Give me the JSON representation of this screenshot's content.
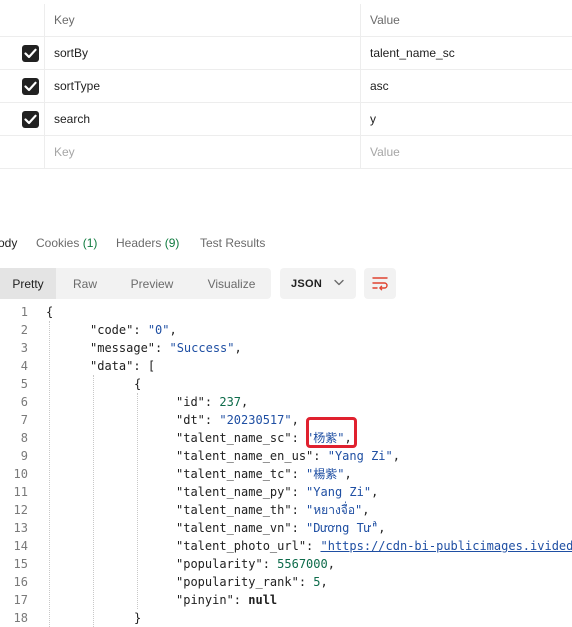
{
  "params": {
    "header": {
      "key": "Key",
      "value": "Value"
    },
    "rows": [
      {
        "key": "sortBy",
        "value": "talent_name_sc",
        "checked": true
      },
      {
        "key": "sortType",
        "value": "asc",
        "checked": true
      },
      {
        "key": "search",
        "value": "y",
        "checked": true
      }
    ],
    "placeholder": {
      "key": "Key",
      "value": "Value"
    }
  },
  "response_tabs": {
    "body": "ody",
    "cookies": "Cookies",
    "cookies_count": "(1)",
    "headers": "Headers",
    "headers_count": "(9)",
    "test_results": "Test Results"
  },
  "view_modes": {
    "pretty": "Pretty",
    "raw": "Raw",
    "preview": "Preview",
    "visualize": "Visualize",
    "active": "Pretty"
  },
  "format_select": {
    "value": "JSON"
  },
  "code": {
    "line_numbers": [
      "1",
      "2",
      "3",
      "4",
      "5",
      "6",
      "7",
      "8",
      "9",
      "10",
      "11",
      "12",
      "13",
      "14",
      "15",
      "16",
      "17",
      "18"
    ],
    "l1": "{",
    "l2_key": "\"code\"",
    "l2_val": "\"0\"",
    "l3_key": "\"message\"",
    "l3_val": "\"Success\"",
    "l4_key": "\"data\"",
    "l4_rest": "[",
    "l5": "{",
    "l6_key": "\"id\"",
    "l6_val": "237",
    "l7_key": "\"dt\"",
    "l7_val": "\"20230517\"",
    "l8_key": "\"talent_name_sc\"",
    "l8_val": "\"杨紫\"",
    "l9_key": "\"talent_name_en_us\"",
    "l9_val": "\"Yang Zi\"",
    "l10_key": "\"talent_name_tc\"",
    "l10_val": "\"楊紫\"",
    "l11_key": "\"talent_name_py\"",
    "l11_val": "\"Yang Zi\"",
    "l12_key": "\"talent_name_th\"",
    "l12_val": "\"หยางจื่อ\"",
    "l13_key": "\"talent_name_vn\"",
    "l13_val": "\"Dương Tử\"",
    "l14_key": "\"talent_photo_url\"",
    "l14_val": "\"https://cdn-bi-publicimages.ivided",
    "l15_key": "\"popularity\"",
    "l15_val": "5567000",
    "l16_key": "\"popularity_rank\"",
    "l16_val": "5",
    "l17_key": "\"pinyin\"",
    "l17_val": "null",
    "l18": "}"
  },
  "colors": {
    "highlight_border": "#e0212f",
    "string": "#1f4fa3",
    "number": "#0d6b4a",
    "count": "#0f7b3f"
  }
}
